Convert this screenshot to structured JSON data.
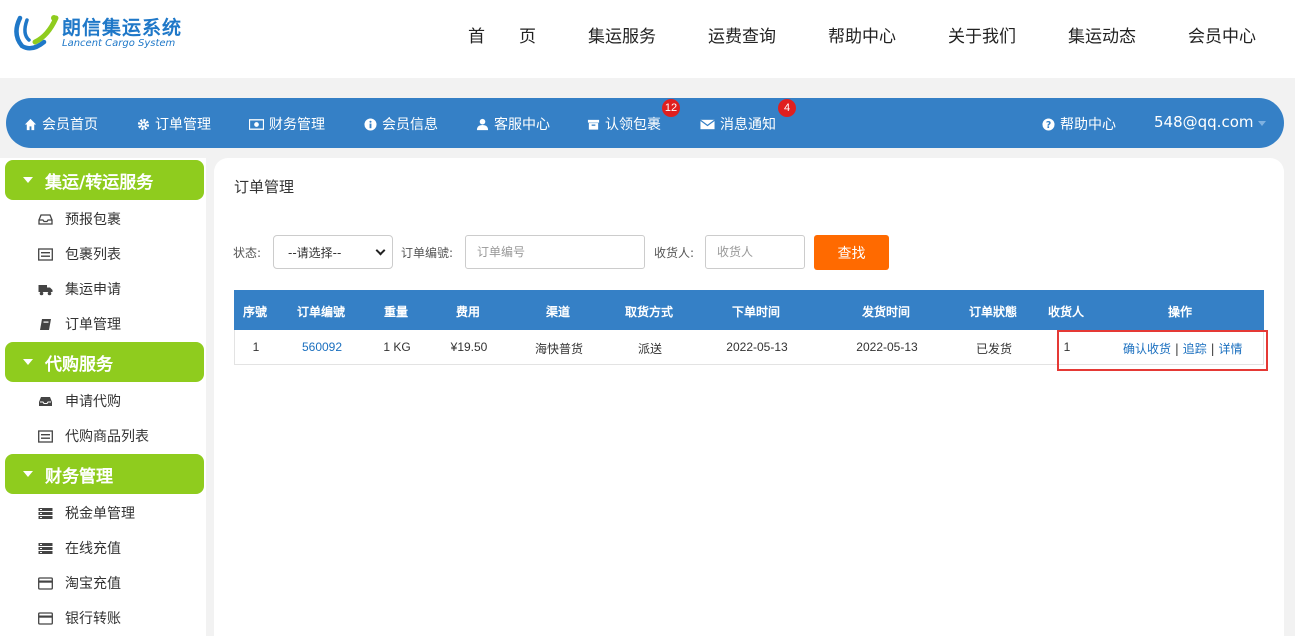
{
  "brand": {
    "name": "朗信集运系统",
    "subtitle": "Lancent Cargo System",
    "colors": {
      "blue": "#1f78c8",
      "green": "#8fcc1e"
    }
  },
  "main_nav": [
    {
      "label": "首　　页",
      "id": "home"
    },
    {
      "label": "集运服务",
      "id": "service"
    },
    {
      "label": "运费查询",
      "id": "freight"
    },
    {
      "label": "帮助中心",
      "id": "help"
    },
    {
      "label": "关于我们",
      "id": "about"
    },
    {
      "label": "集运动态",
      "id": "news"
    },
    {
      "label": "会员中心",
      "id": "member"
    }
  ],
  "member_nav": {
    "items": [
      {
        "label": "会员首页",
        "icon": "home-icon"
      },
      {
        "label": "订单管理",
        "icon": "gear-icon"
      },
      {
        "label": "财务管理",
        "icon": "money-icon"
      },
      {
        "label": "会员信息",
        "icon": "info-icon"
      },
      {
        "label": "客服中心",
        "icon": "user-icon"
      },
      {
        "label": "认领包裹",
        "icon": "archive-icon",
        "badge": "12"
      },
      {
        "label": "消息通知",
        "icon": "envelope-icon",
        "badge": "4"
      }
    ],
    "help": {
      "label": "帮助中心",
      "icon": "question-icon"
    },
    "user_email": "548@qq.com",
    "color": "#3580c6"
  },
  "sidebar": {
    "sections": [
      {
        "title": "集运/转运服务",
        "items": [
          {
            "label": "预报包裹",
            "icon": "inbox-icon"
          },
          {
            "label": "包裹列表",
            "icon": "list-icon"
          },
          {
            "label": "集运申请",
            "icon": "truck-icon"
          },
          {
            "label": "订单管理",
            "icon": "book-icon"
          }
        ]
      },
      {
        "title": "代购服务",
        "items": [
          {
            "label": "申请代购",
            "icon": "tray-icon"
          },
          {
            "label": "代购商品列表",
            "icon": "list-icon"
          }
        ]
      },
      {
        "title": "财务管理",
        "items": [
          {
            "label": "税金单管理",
            "icon": "tasks-icon"
          },
          {
            "label": "在线充值",
            "icon": "tasks-icon"
          },
          {
            "label": "淘宝充值",
            "icon": "card-icon"
          },
          {
            "label": "银行转账",
            "icon": "card-icon"
          }
        ]
      }
    ]
  },
  "panel": {
    "title": "订单管理",
    "filters": {
      "status_label": "状态:",
      "status_value": "--请选择--",
      "order_no_label": "订单编號:",
      "order_no_placeholder": "订单编号",
      "receiver_label": "收货人:",
      "receiver_placeholder": "收货人",
      "search_label": "查找",
      "search_color": "#ff6a00"
    },
    "table": {
      "headers": [
        "序號",
        "订单编號",
        "重量",
        "费用",
        "渠道",
        "取货方式",
        "下单时间",
        "发货时间",
        "订单狀態",
        "收货人",
        "操作"
      ],
      "rows": [
        {
          "seq": "1",
          "order_no": "560092",
          "weight": "1 KG",
          "fee": "¥19.50",
          "channel": "海快普货",
          "pickup": "派送",
          "order_time": "2022-05-13",
          "ship_time": "2022-05-13",
          "status": "已发货",
          "receiver": "1",
          "actions": [
            "确认收货",
            "追踪",
            "详情"
          ],
          "separator": "|"
        }
      ]
    },
    "highlight_color": "#e53935"
  }
}
